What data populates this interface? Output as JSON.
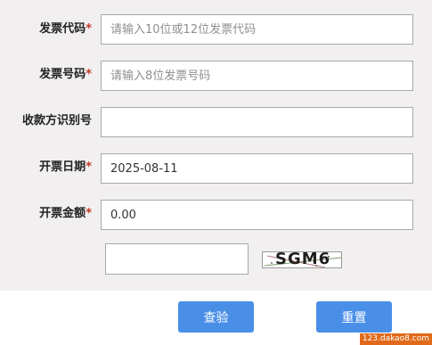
{
  "form": {
    "invoice_code": {
      "label": "发票代码",
      "required_mark": "*",
      "placeholder": "请输入10位或12位发票代码",
      "value": ""
    },
    "invoice_number": {
      "label": "发票号码",
      "required_mark": "*",
      "placeholder": "请输入8位发票号码",
      "value": ""
    },
    "taxpayer_id": {
      "label": "收款方识别号",
      "placeholder": "",
      "value": ""
    },
    "invoice_date": {
      "label": "开票日期",
      "required_mark": "*",
      "value": "2025-08-11"
    },
    "invoice_amount": {
      "label": "开票金额",
      "required_mark": "*",
      "value": "0.00"
    },
    "captcha": {
      "value": "",
      "image_text": "SGM6"
    }
  },
  "buttons": {
    "query_label": "查验",
    "reset_label": "重置"
  },
  "watermark": "123.dakao8.com",
  "colors": {
    "button": "#4a8fe7",
    "required": "#c0392b",
    "panel_bg": "#f1efef",
    "watermark_bg": "#e06a1a"
  }
}
